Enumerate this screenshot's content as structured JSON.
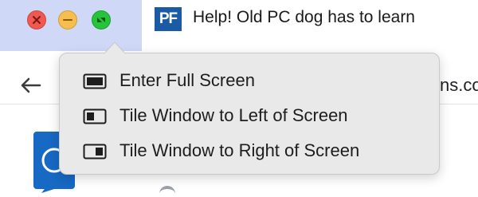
{
  "window_controls": {
    "close_icon": "close-icon",
    "minimize_icon": "minimize-icon",
    "zoom_icon": "zoom-icon",
    "colors": {
      "close": "#ee5a52",
      "minimize": "#f6be4f",
      "zoom": "#27c33b"
    }
  },
  "tab": {
    "favicon_text": "PF",
    "title": "Help! Old PC dog has to learn"
  },
  "toolbar": {
    "back_icon": "back-arrow-icon",
    "url_fragment": "ns.co"
  },
  "window_menu": {
    "items": [
      {
        "label": "Enter Full Screen",
        "icon": "fullscreen-icon"
      },
      {
        "label": "Tile Window to Left of Screen",
        "icon": "tile-left-icon"
      },
      {
        "label": "Tile Window to Right of Screen",
        "icon": "tile-right-icon"
      }
    ]
  }
}
